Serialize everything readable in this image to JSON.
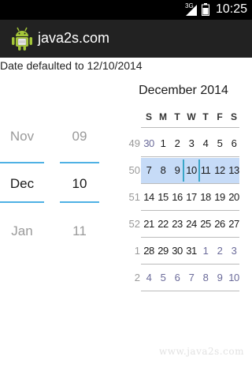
{
  "status_bar": {
    "network": "3G",
    "time": "10:25"
  },
  "action_bar": {
    "title": "java2s.com",
    "icon": "android-robot-icon"
  },
  "default_text": "Date defaulted to 12/10/2014",
  "spinners": {
    "month": {
      "prev": "Nov",
      "current": "Dec",
      "next": "Jan"
    },
    "day": {
      "prev": "09",
      "current": "10",
      "next": "11"
    }
  },
  "calendar": {
    "month_label": "December 2014",
    "weekdays": [
      "S",
      "M",
      "T",
      "W",
      "T",
      "F",
      "S"
    ],
    "weeks": [
      {
        "week": "49",
        "days": [
          "30",
          "1",
          "2",
          "3",
          "4",
          "5",
          "6"
        ],
        "other": [
          true,
          false,
          false,
          false,
          false,
          false,
          false
        ]
      },
      {
        "week": "50",
        "days": [
          "7",
          "8",
          "9",
          "10",
          "11",
          "12",
          "13"
        ],
        "other": [
          false,
          false,
          false,
          false,
          false,
          false,
          false
        ]
      },
      {
        "week": "51",
        "days": [
          "14",
          "15",
          "16",
          "17",
          "18",
          "19",
          "20"
        ],
        "other": [
          false,
          false,
          false,
          false,
          false,
          false,
          false
        ]
      },
      {
        "week": "52",
        "days": [
          "21",
          "22",
          "23",
          "24",
          "25",
          "26",
          "27"
        ],
        "other": [
          false,
          false,
          false,
          false,
          false,
          false,
          false
        ]
      },
      {
        "week": "1",
        "days": [
          "28",
          "29",
          "30",
          "31",
          "1",
          "2",
          "3"
        ],
        "other": [
          false,
          false,
          false,
          false,
          true,
          true,
          true
        ]
      },
      {
        "week": "2",
        "days": [
          "4",
          "5",
          "6",
          "7",
          "8",
          "9",
          "10"
        ],
        "other": [
          true,
          true,
          true,
          true,
          true,
          true,
          true
        ]
      }
    ],
    "selected_week": "50",
    "selected_day": "10"
  },
  "colors": {
    "accent": "#4fb1e4",
    "selected_week_bg": "#c6dbf7",
    "action_bar_bg": "#222222"
  },
  "watermark": "www.java2s.com"
}
